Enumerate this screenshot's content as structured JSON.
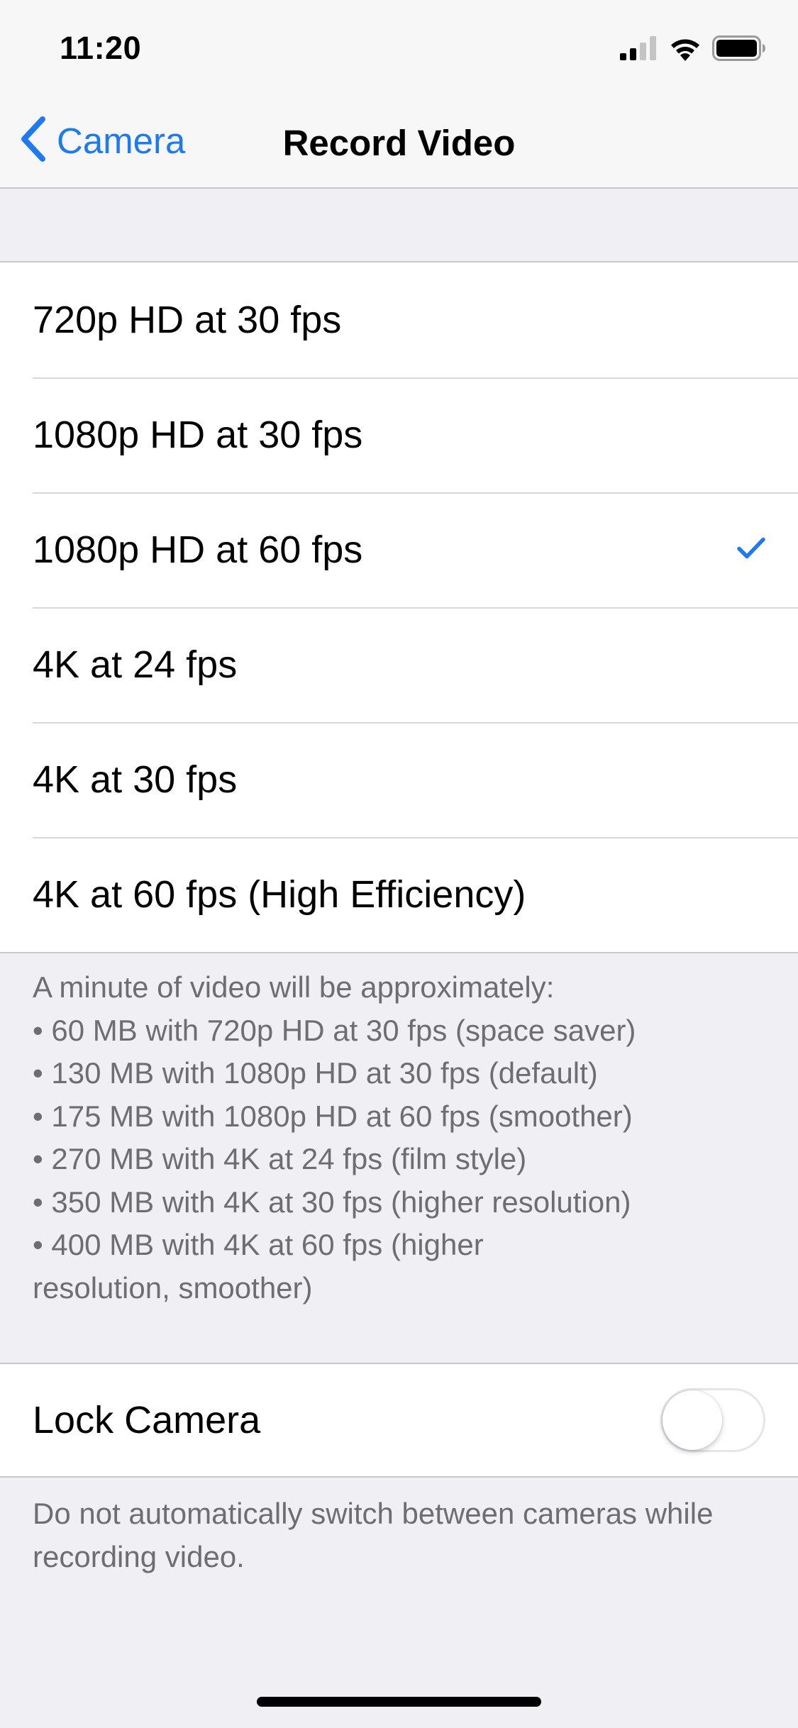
{
  "status_bar": {
    "time": "11:20",
    "icons": [
      "cellular-signal-icon",
      "wifi-icon",
      "battery-icon"
    ]
  },
  "nav": {
    "back_label": "Camera",
    "title": "Record Video"
  },
  "options": [
    {
      "label": "720p HD at 30 fps",
      "selected": false
    },
    {
      "label": "1080p HD at 30 fps",
      "selected": false
    },
    {
      "label": "1080p HD at 60 fps",
      "selected": true
    },
    {
      "label": "4K at 24 fps",
      "selected": false
    },
    {
      "label": "4K at 30 fps",
      "selected": false
    },
    {
      "label": "4K at 60 fps (High Efficiency)",
      "selected": false
    }
  ],
  "info": {
    "heading": "A minute of video will be approximately:",
    "lines": [
      "• 60 MB with 720p HD at 30 fps (space saver)",
      "• 130 MB with 1080p HD at 30 fps (default)",
      "• 175 MB with 1080p HD at 60 fps (smoother)",
      "• 270 MB with 4K at 24 fps (film style)",
      "• 350 MB with 4K at 30 fps (higher resolution)",
      "• 400 MB with 4K at 60 fps (higher\nresolution, smoother)"
    ]
  },
  "lock_camera": {
    "label": "Lock Camera",
    "enabled": false,
    "footer": "Do not automatically switch between cameras while recording video."
  },
  "colors": {
    "accent": "#1f7aef",
    "background": "#efeff4",
    "secondary_text": "#6d6d72"
  }
}
